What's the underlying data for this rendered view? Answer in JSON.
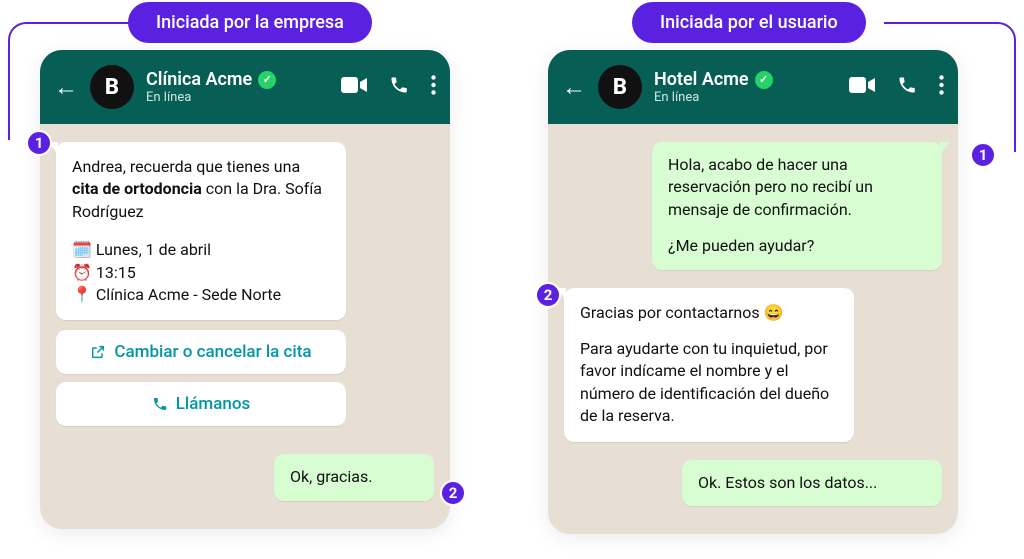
{
  "labels": {
    "business_initiated": "Iniciada por la empresa",
    "user_initiated": "Iniciada por el usuario"
  },
  "badges": {
    "one": "1",
    "two": "2"
  },
  "left": {
    "avatar_letter": "B",
    "name": "Clínica Acme",
    "status": "En línea",
    "msg_line1": "Andrea, recuerda que tienes una ",
    "msg_bold": "cita de ortodoncia",
    "msg_line1b": " con la Dra. Sofía Rodríguez",
    "detail_date": "🗓️ Lunes, 1 de abril",
    "detail_time": "⏰ 13:15",
    "detail_place": "📍 Clínica Acme - Sede Norte",
    "btn_change": "Cambiar o cancelar la cita",
    "btn_call": "Llámanos",
    "reply": "Ok, gracias."
  },
  "right": {
    "avatar_letter": "B",
    "name": "Hotel Acme",
    "status": "En línea",
    "user_msg_p1": "Hola, acabo de hacer una reservación pero no recibí un mensaje de confirmación.",
    "user_msg_p2": "¿Me pueden ayudar?",
    "bot_msg_p1": "Gracias por contactarnos 😄",
    "bot_msg_p2": "Para ayudarte con tu inquietud, por favor indícame el nombre y el número de identificación del dueño de la reserva.",
    "reply": "Ok. Estos son los datos..."
  }
}
